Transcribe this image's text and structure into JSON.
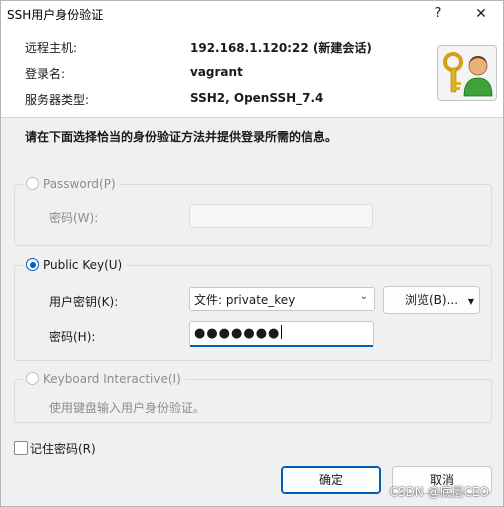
{
  "window": {
    "title": "SSH用户身份验证",
    "help_symbol": "?",
    "close_symbol": "✕"
  },
  "header": {
    "rows": [
      {
        "label": "远程主机:",
        "value": "192.168.1.120:22 (新建会话)"
      },
      {
        "label": "登录名:",
        "value": "vagrant"
      },
      {
        "label": "服务器类型:",
        "value": "SSH2, OpenSSH_7.4"
      }
    ],
    "icon": "key-user-icon"
  },
  "prompt": "请在下面选择恰当的身份验证方法并提供登录所需的信息。",
  "password_group": {
    "radio_label": "Password(P)",
    "selected": false,
    "enabled": false,
    "field_label": "密码(W):",
    "field_value": ""
  },
  "publickey_group": {
    "radio_label": "Public Key(U)",
    "selected": true,
    "key_label": "用户密钥(K):",
    "key_value": "文件: private_key",
    "browse_label": "浏览(B)...",
    "password_label": "密码(H):",
    "password_value": "●●●●●●●"
  },
  "keyboard_group": {
    "radio_label": "Keyboard Interactive(I)",
    "selected": false,
    "enabled": false,
    "description": "使用键盘输入用户身份验证。"
  },
  "remember": {
    "label": "记住密码(R)",
    "checked": false
  },
  "buttons": {
    "ok": "确定",
    "cancel": "取消"
  },
  "watermark": "CSDN @底层CEO",
  "colors": {
    "accent": "#005fb8",
    "background": "#f0f0f0",
    "header_bg": "#ffffff"
  }
}
